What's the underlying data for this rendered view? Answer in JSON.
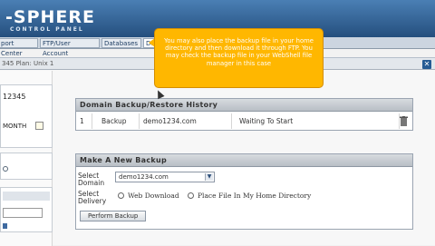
{
  "header": {
    "brand": "-SPHERE",
    "brand_sub": "CONTROL PANEL"
  },
  "tabs": [
    {
      "label": "port Center"
    },
    {
      "label": "FTP/User Account"
    },
    {
      "label": "Databases"
    },
    {
      "label": "Do"
    }
  ],
  "window": {
    "title": "345 Plan: Unix 1",
    "close_label": "✕"
  },
  "sidebar": {
    "account_id": "12345",
    "period": "MONTH",
    "icon_search": "search-icon"
  },
  "tooltip": {
    "text": "You may also place the backup file in your home directory and then download it through FTP. You may check the backup file in your WebShell file manager in this case"
  },
  "history": {
    "title": "Domain Backup/Restore History",
    "rows": [
      {
        "num": "1",
        "type": "Backup",
        "domain": "demo1234.com",
        "status": "Waiting To Start"
      }
    ]
  },
  "new_backup": {
    "title": "Make A New Backup",
    "select_domain_label": "Select Domain",
    "domain_value": "demo1234.com",
    "select_delivery_label": "Select Delivery",
    "option_web": "Web Download",
    "option_home": "Place File In My Home Directory",
    "perform_label": "Perform Backup"
  },
  "colors": {
    "accent": "#255b94",
    "tooltip": "#ffb700"
  }
}
